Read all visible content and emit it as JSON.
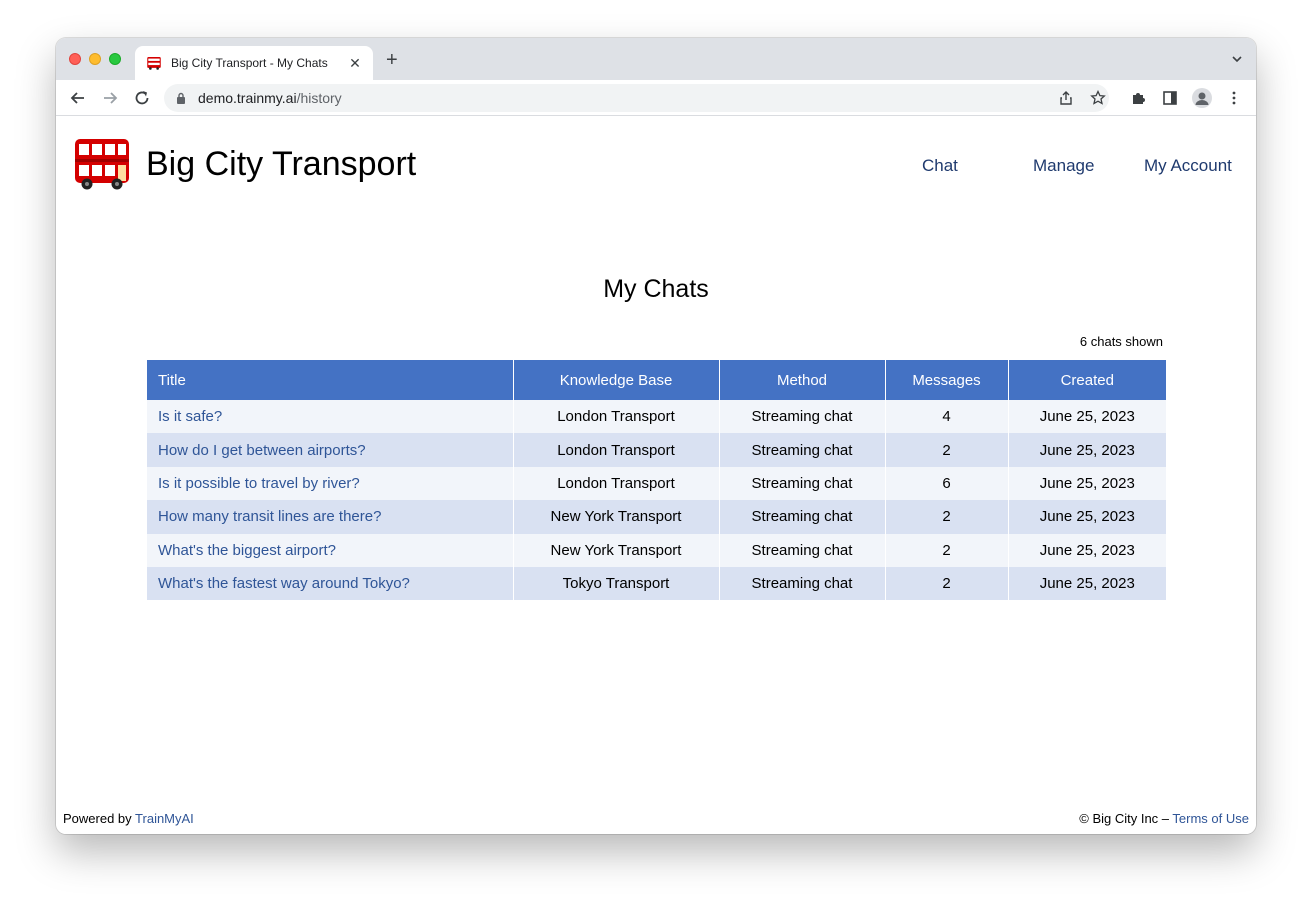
{
  "browser": {
    "tab_title": "Big City Transport - My Chats",
    "url_host": "demo.trainmy.ai",
    "url_path": "/history"
  },
  "header": {
    "site_title": "Big City Transport",
    "nav": [
      "Chat",
      "Manage",
      "My Account"
    ]
  },
  "main": {
    "heading": "My Chats",
    "count_text": "6 chats shown",
    "columns": [
      "Title",
      "Knowledge Base",
      "Method",
      "Messages",
      "Created"
    ],
    "rows": [
      {
        "title": "Is it safe?",
        "kb": "London Transport",
        "method": "Streaming chat",
        "messages": "4",
        "created": "June 25, 2023"
      },
      {
        "title": "How do I get between airports?",
        "kb": "London Transport",
        "method": "Streaming chat",
        "messages": "2",
        "created": "June 25, 2023"
      },
      {
        "title": "Is it possible to travel by river?",
        "kb": "London Transport",
        "method": "Streaming chat",
        "messages": "6",
        "created": "June 25, 2023"
      },
      {
        "title": "How many transit lines are there?",
        "kb": "New York Transport",
        "method": "Streaming chat",
        "messages": "2",
        "created": "June 25, 2023"
      },
      {
        "title": "What's the biggest airport?",
        "kb": "New York Transport",
        "method": "Streaming chat",
        "messages": "2",
        "created": "June 25, 2023"
      },
      {
        "title": "What's the fastest way around Tokyo?",
        "kb": "Tokyo Transport",
        "method": "Streaming chat",
        "messages": "2",
        "created": "June 25, 2023"
      }
    ]
  },
  "footer": {
    "powered_by": "Powered by",
    "powered_link": "TrainMyAI",
    "copyright": "© Big City Inc –",
    "terms_link": "Terms of Use"
  },
  "colors": {
    "header_blue": "#4472c4",
    "row_light": "#f2f5fa",
    "row_dark": "#d9e1f2",
    "link_blue": "#2f5597",
    "bus_red": "#d40000"
  },
  "icons": [
    "bus-logo-icon",
    "back-arrow-icon",
    "forward-arrow-icon",
    "reload-icon",
    "lock-icon",
    "share-icon",
    "bookmark-star-icon",
    "extensions-icon",
    "side-panel-icon",
    "profile-icon",
    "more-menu-icon",
    "close-icon",
    "new-tab-icon",
    "tab-menu-chevron-icon"
  ]
}
